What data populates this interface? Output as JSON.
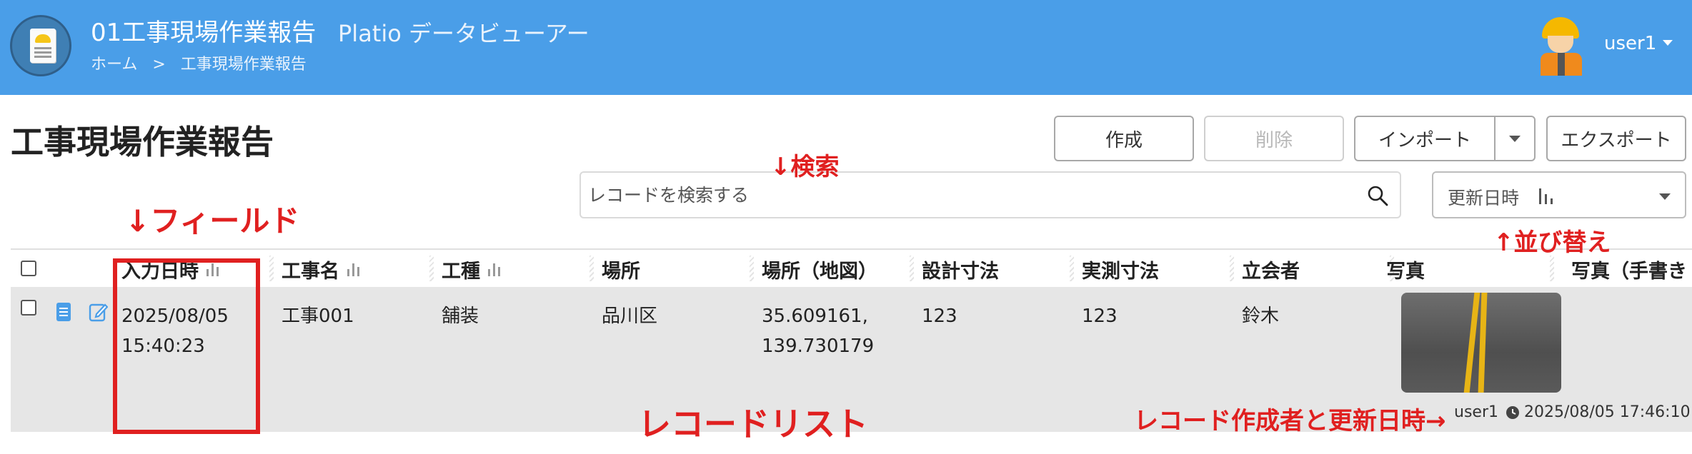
{
  "header": {
    "app_title": "01工事現場作業報告",
    "app_subtitle": "Platio データビューアー",
    "breadcrumb": [
      "ホーム",
      ">",
      "工事現場作業報告"
    ],
    "user_name": "user1",
    "background_color": "#4a9ee8"
  },
  "page": {
    "title": "工事現場作業報告"
  },
  "toolbar": {
    "create_label": "作成",
    "delete_label": "削除",
    "import_label": "インポート",
    "export_label": "エクスポート"
  },
  "search": {
    "placeholder": "レコードを検索する",
    "value": ""
  },
  "sort": {
    "selected": "更新日時"
  },
  "table": {
    "columns": [
      "入力日時",
      "工事名",
      "工種",
      "場所",
      "場所（地図）",
      "設計寸法",
      "実測寸法",
      "立会者",
      "写真",
      "写真（手書き"
    ],
    "rows": [
      {
        "input_datetime_date": "2025/08/05",
        "input_datetime_time": "15:40:23",
        "project_name": "工事001",
        "work_type": "舗装",
        "location": "品川区",
        "map_lat": "35.609161,",
        "map_lng": "139.730179",
        "design_size": "123",
        "measured_size": "123",
        "witness": "鈴木",
        "creator": "user1",
        "updated_at": "2025/08/05 17:46:10"
      }
    ]
  },
  "annotations": {
    "search": "↓検索",
    "field": "↓フィールド",
    "sort": "↑並び替え",
    "record_list": "レコードリスト",
    "record_meta": "レコード作成者と更新日時→",
    "color": "#e02020"
  }
}
